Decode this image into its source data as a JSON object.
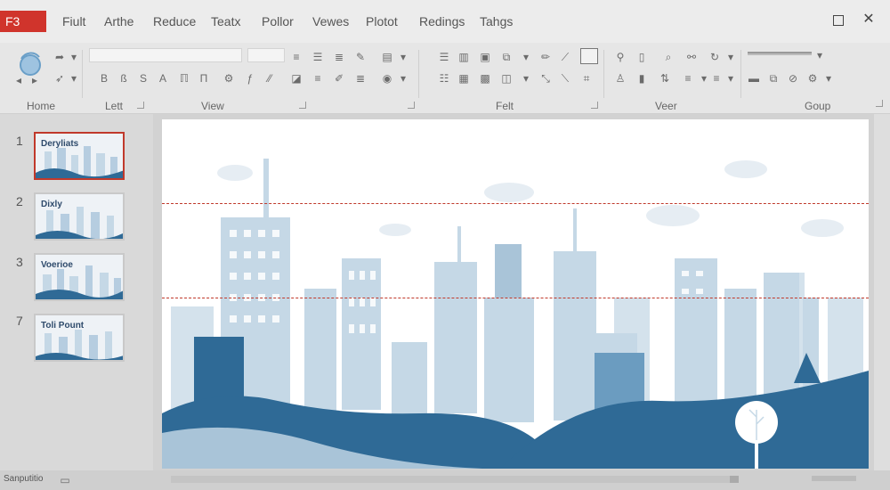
{
  "window": {
    "app_badge": "F3",
    "tabs": [
      "Fiult",
      "Arthe",
      "Reduce",
      "Teatx",
      "Pollor",
      "Vewes",
      "Plotot",
      "Redings",
      "Tahgs"
    ],
    "restore_icon": "restore-window-icon",
    "close_icon": "close-icon"
  },
  "ribbon": {
    "groups": [
      "Home",
      "Lett",
      "View",
      "Felt",
      "Veer",
      "Goup"
    ]
  },
  "thumbnails": [
    {
      "number": "1",
      "title": "Deryliats",
      "selected": true
    },
    {
      "number": "2",
      "title": "Dixly",
      "selected": false
    },
    {
      "number": "3",
      "title": "Voerioe",
      "selected": false
    },
    {
      "number": "7",
      "title": "Toli Pount",
      "selected": false
    }
  ],
  "status": {
    "text": "Sanputitio"
  },
  "colors": {
    "accent": "#d0342c",
    "hill_dark": "#2f6a96",
    "hill_light": "#a9c4d8",
    "building_light": "#c5d8e6",
    "guide": "#c0392b"
  }
}
